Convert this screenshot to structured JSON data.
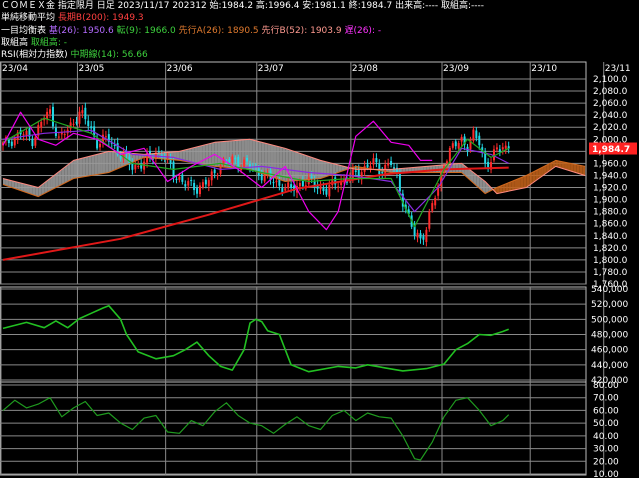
{
  "header": {
    "line1": "ＣＯＭＥＸ金 指定限月 日足 2023/11/17 202312 始:1984.2 高:1996.4 安:1981.1 終:1984.7 出来高:---- 取組高:----",
    "sma_label": "単純移動平均",
    "sma_value": "長期B(200): 1949.3",
    "ichimoku_label": "一目均衡表",
    "kijun": "基(26): 1950.6",
    "tenkan": "転(9): 1966.0",
    "senkou_a": "先行A(26): 1890.5",
    "senkou_b": "先行B(52): 1903.9",
    "chikou": "遅(26): -",
    "oi_label": "取組高",
    "oi_value": "取組高: -",
    "rsi_label": "RSI(相対力指数)",
    "rsi_value": "中期線(14): 56.66"
  },
  "colors": {
    "up": "#ff2a2a",
    "down": "#22d8e6",
    "sma": "#e01818",
    "kijun": "#8a2be2",
    "tenkan": "#22a822",
    "senkou_a": "#d2691e",
    "senkou_b": "#ff8a80",
    "chikou": "#ee00ee",
    "cloud_up": "#c0601a",
    "cloud_down": "#9a9a9a",
    "oi": "#22c022",
    "rsi": "#1f9a1f",
    "last_price_bg": "#ff2222"
  },
  "chart_data": [
    {
      "type": "candlestick",
      "title": "ＣＯＭＥＸ金 指定限月 日足",
      "x_ticks": [
        "23/04",
        "23/05",
        "23/06",
        "23/07",
        "23/08",
        "23/09",
        "23/10",
        "23/11"
      ],
      "ylim": [
        1760,
        2100
      ],
      "y_ticks": [
        1760,
        1780,
        1800,
        1820,
        1840,
        1860,
        1880,
        1900,
        1920,
        1940,
        1960,
        1980,
        2000,
        2020,
        2040,
        2060,
        2080,
        2100
      ],
      "y_tick_labels": [
        "1,760.0",
        "1,780.0",
        "1,800.0",
        "1,820.0",
        "1,840.0",
        "1,860.0",
        "1,880.0",
        "1,900.0",
        "1,920.0",
        "1,940.0",
        "1,960.0",
        "1,980.0",
        "2,000.0",
        "2,020.0",
        "2,040.0",
        "2,060.0",
        "2,080.0",
        "2,100.0"
      ],
      "last_price": 1984.7,
      "last_price_label": "1,984.7",
      "close_anchors": [
        [
          0,
          1990
        ],
        [
          6,
          2010
        ],
        [
          10,
          2000
        ],
        [
          14,
          2035
        ],
        [
          16,
          2045
        ],
        [
          19,
          2000
        ],
        [
          22,
          2015
        ],
        [
          26,
          2045
        ],
        [
          29,
          2025
        ],
        [
          32,
          1995
        ],
        [
          36,
          2000
        ],
        [
          40,
          1975
        ],
        [
          44,
          1955
        ],
        [
          48,
          1960
        ],
        [
          52,
          1980
        ],
        [
          55,
          1970
        ],
        [
          58,
          1945
        ],
        [
          62,
          1925
        ],
        [
          66,
          1920
        ],
        [
          70,
          1930
        ],
        [
          74,
          1960
        ],
        [
          78,
          1965
        ],
        [
          82,
          1960
        ],
        [
          86,
          1950
        ],
        [
          90,
          1935
        ],
        [
          94,
          1925
        ],
        [
          98,
          1915
        ],
        [
          102,
          1930
        ],
        [
          106,
          1925
        ],
        [
          110,
          1915
        ],
        [
          114,
          1930
        ],
        [
          118,
          1935
        ],
        [
          122,
          1950
        ],
        [
          126,
          1960
        ],
        [
          128,
          1950
        ],
        [
          132,
          1960
        ],
        [
          134,
          1935
        ],
        [
          136,
          1900
        ],
        [
          138,
          1870
        ],
        [
          140,
          1840
        ],
        [
          142,
          1835
        ],
        [
          144,
          1855
        ],
        [
          146,
          1890
        ],
        [
          148,
          1920
        ],
        [
          150,
          1965
        ],
        [
          152,
          1980
        ],
        [
          154,
          1990
        ],
        [
          156,
          2000
        ],
        [
          158,
          1990
        ],
        [
          160,
          2005
        ],
        [
          162,
          1995
        ],
        [
          164,
          1960
        ],
        [
          166,
          1965
        ],
        [
          168,
          1980
        ],
        [
          170,
          1990
        ],
        [
          172,
          1985
        ]
      ],
      "sma200": [
        [
          0,
          1800
        ],
        [
          40,
          1835
        ],
        [
          70,
          1875
        ],
        [
          100,
          1918
        ],
        [
          130,
          1942
        ],
        [
          150,
          1950
        ],
        [
          172,
          1953
        ]
      ],
      "kijun": [
        [
          0,
          2000
        ],
        [
          14,
          2010
        ],
        [
          30,
          2015
        ],
        [
          44,
          1975
        ],
        [
          58,
          1970
        ],
        [
          74,
          1950
        ],
        [
          88,
          1955
        ],
        [
          104,
          1945
        ],
        [
          118,
          1940
        ],
        [
          132,
          1930
        ],
        [
          140,
          1880
        ],
        [
          148,
          1920
        ],
        [
          156,
          1985
        ],
        [
          166,
          1975
        ],
        [
          172,
          1960
        ]
      ],
      "tenkan": [
        [
          0,
          1995
        ],
        [
          14,
          2035
        ],
        [
          30,
          2010
        ],
        [
          44,
          1960
        ],
        [
          58,
          1950
        ],
        [
          74,
          1960
        ],
        [
          88,
          1945
        ],
        [
          104,
          1930
        ],
        [
          118,
          1935
        ],
        [
          132,
          1935
        ],
        [
          140,
          1855
        ],
        [
          150,
          1950
        ],
        [
          158,
          2000
        ],
        [
          166,
          1970
        ],
        [
          172,
          1985
        ]
      ],
      "chikou": [
        [
          0,
          1990
        ],
        [
          6,
          2045
        ],
        [
          12,
          2000
        ],
        [
          18,
          1990
        ],
        [
          24,
          2010
        ],
        [
          32,
          2000
        ],
        [
          40,
          1975
        ],
        [
          48,
          1985
        ],
        [
          56,
          1930
        ],
        [
          64,
          1955
        ],
        [
          72,
          1975
        ],
        [
          80,
          1950
        ],
        [
          88,
          1920
        ],
        [
          96,
          1955
        ],
        [
          104,
          1880
        ],
        [
          110,
          1850
        ],
        [
          114,
          1880
        ],
        [
          120,
          2005
        ],
        [
          126,
          2030
        ],
        [
          132,
          1995
        ],
        [
          138,
          1990
        ],
        [
          142,
          1965
        ],
        [
          146,
          1965
        ]
      ],
      "senkou_a": [
        [
          0,
          1925
        ],
        [
          12,
          1905
        ],
        [
          24,
          1935
        ],
        [
          36,
          1945
        ],
        [
          48,
          1970
        ],
        [
          60,
          1965
        ],
        [
          72,
          1955
        ],
        [
          84,
          1950
        ],
        [
          96,
          1930
        ],
        [
          108,
          1935
        ],
        [
          120,
          1955
        ],
        [
          132,
          1945
        ],
        [
          144,
          1945
        ],
        [
          156,
          1945
        ],
        [
          164,
          1910
        ],
        [
          168,
          1920
        ],
        [
          178,
          1940
        ],
        [
          188,
          1965
        ],
        [
          198,
          1955
        ]
      ],
      "senkou_b": [
        [
          0,
          1935
        ],
        [
          12,
          1920
        ],
        [
          24,
          1965
        ],
        [
          36,
          1980
        ],
        [
          48,
          1975
        ],
        [
          60,
          1980
        ],
        [
          72,
          1995
        ],
        [
          84,
          2000
        ],
        [
          96,
          1985
        ],
        [
          108,
          1965
        ],
        [
          120,
          1950
        ],
        [
          132,
          1950
        ],
        [
          144,
          1955
        ],
        [
          156,
          1960
        ],
        [
          164,
          1930
        ],
        [
          168,
          1910
        ],
        [
          178,
          1920
        ],
        [
          188,
          1955
        ],
        [
          198,
          1940
        ]
      ]
    },
    {
      "type": "line",
      "title": "取組高",
      "ylim": [
        420000,
        540000
      ],
      "y_ticks": [
        420000,
        440000,
        460000,
        480000,
        500000,
        520000,
        540000
      ],
      "y_tick_labels": [
        "420,000",
        "440,000",
        "460,000",
        "480,000",
        "500,000",
        "520,000",
        "540,000"
      ],
      "series": [
        {
          "points": [
            [
              0,
              488000
            ],
            [
              8,
              496000
            ],
            [
              14,
              489000
            ],
            [
              18,
              498000
            ],
            [
              22,
              489000
            ],
            [
              26,
              501000
            ],
            [
              30,
              508000
            ],
            [
              34,
              515000
            ],
            [
              36,
              518000
            ],
            [
              40,
              500000
            ],
            [
              42,
              480000
            ],
            [
              46,
              457000
            ],
            [
              52,
              448000
            ],
            [
              58,
              452000
            ],
            [
              62,
              460000
            ],
            [
              66,
              470000
            ],
            [
              70,
              452000
            ],
            [
              74,
              438000
            ],
            [
              78,
              433000
            ],
            [
              82,
              460000
            ],
            [
              84,
              495000
            ],
            [
              86,
              500000
            ],
            [
              88,
              497000
            ],
            [
              90,
              485000
            ],
            [
              94,
              480000
            ],
            [
              98,
              440000
            ],
            [
              104,
              431000
            ],
            [
              114,
              438000
            ],
            [
              120,
              436000
            ],
            [
              124,
              440000
            ],
            [
              130,
              436000
            ],
            [
              136,
              432000
            ],
            [
              144,
              435000
            ],
            [
              150,
              441000
            ],
            [
              154,
              460000
            ],
            [
              158,
              468000
            ],
            [
              162,
              480000
            ],
            [
              166,
              479000
            ],
            [
              170,
              484000
            ],
            [
              172,
              487000
            ]
          ]
        }
      ]
    },
    {
      "type": "line",
      "title": "RSI(相対力指数)",
      "ylim": [
        10,
        80
      ],
      "y_ticks": [
        10,
        20,
        30,
        40,
        50,
        60,
        70,
        80
      ],
      "y_tick_labels": [
        "10.00",
        "20.00",
        "30.00",
        "40.00",
        "50.00",
        "60.00",
        "70.00",
        "80.00"
      ],
      "series": [
        {
          "name": "中期線(14)",
          "points": [
            [
              0,
              60
            ],
            [
              4,
              68
            ],
            [
              8,
              62
            ],
            [
              12,
              65
            ],
            [
              16,
              70
            ],
            [
              20,
              55
            ],
            [
              24,
              62
            ],
            [
              28,
              67
            ],
            [
              32,
              56
            ],
            [
              36,
              58
            ],
            [
              40,
              50
            ],
            [
              44,
              45
            ],
            [
              48,
              54
            ],
            [
              52,
              56
            ],
            [
              56,
              43
            ],
            [
              60,
              42
            ],
            [
              64,
              52
            ],
            [
              68,
              48
            ],
            [
              72,
              59
            ],
            [
              76,
              66
            ],
            [
              80,
              56
            ],
            [
              84,
              50
            ],
            [
              88,
              48
            ],
            [
              92,
              42
            ],
            [
              96,
              49
            ],
            [
              100,
              55
            ],
            [
              104,
              48
            ],
            [
              108,
              45
            ],
            [
              112,
              56
            ],
            [
              116,
              60
            ],
            [
              120,
              52
            ],
            [
              124,
              58
            ],
            [
              128,
              55
            ],
            [
              132,
              54
            ],
            [
              136,
              40
            ],
            [
              140,
              22
            ],
            [
              142,
              21
            ],
            [
              146,
              35
            ],
            [
              150,
              55
            ],
            [
              154,
              68
            ],
            [
              158,
              70
            ],
            [
              162,
              60
            ],
            [
              166,
              48
            ],
            [
              170,
              52
            ],
            [
              172,
              56.66
            ]
          ]
        }
      ]
    }
  ]
}
